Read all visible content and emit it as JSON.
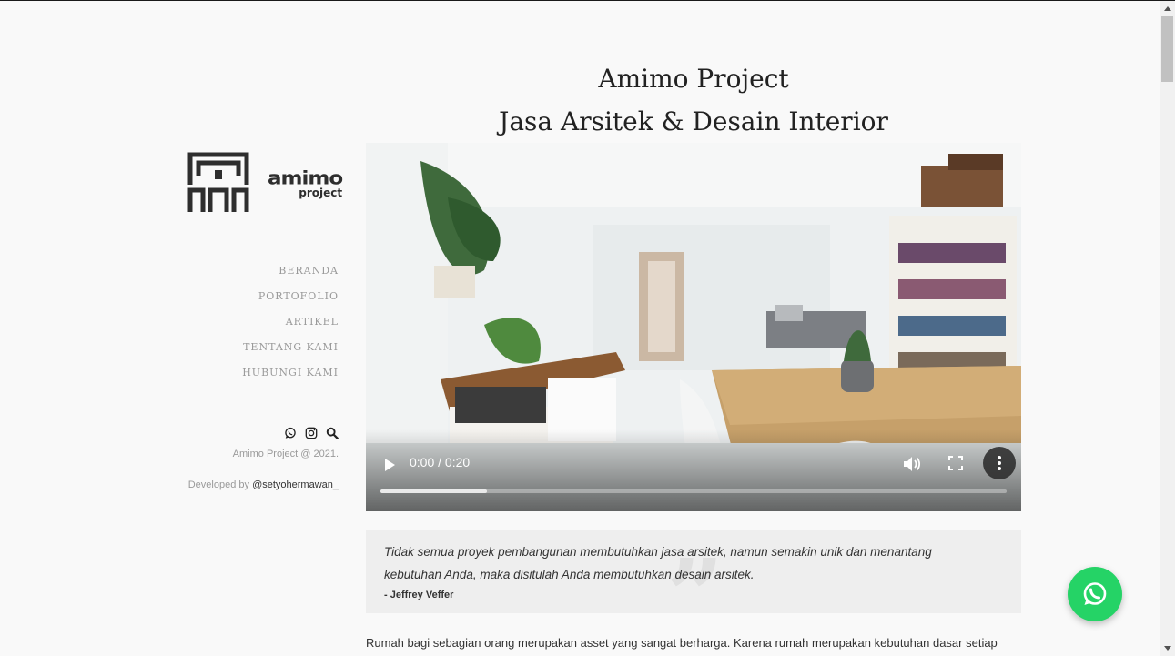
{
  "brand": {
    "wordmark": "amimo",
    "sub": "project"
  },
  "nav": [
    {
      "label": "BERANDA"
    },
    {
      "label": "PORTOFOLIO"
    },
    {
      "label": "ARTIKEL"
    },
    {
      "label": "TENTANG KAMI"
    },
    {
      "label": "HUBUNGI KAMI"
    }
  ],
  "social": [
    "whatsapp-icon",
    "instagram-icon",
    "search-icon"
  ],
  "footer": {
    "copyright": "Amimo Project @ 2021.",
    "developed_prefix": "Developed by ",
    "developer": "@setyohermawan_"
  },
  "header": {
    "line1": "Amimo Project",
    "line2": "Jasa Arsitek & Desain Interior"
  },
  "video": {
    "time": "0:00 / 0:20",
    "buffered": 0.17
  },
  "quote": {
    "text": "Tidak semua proyek pembangunan membutuhkan jasa arsitek, namun semakin unik dan menantang kebutuhan Anda, maka disitulah Anda membutuhkan desain arsitek.",
    "author": "- Jeffrey Veffer"
  },
  "body": {
    "intro": "Rumah bagi sebagian orang merupakan asset yang sangat berharga. Karena rumah merupakan kebutuhan dasar setiap"
  },
  "colors": {
    "whatsapp": "#25d366",
    "background": "#f9f9f9"
  }
}
